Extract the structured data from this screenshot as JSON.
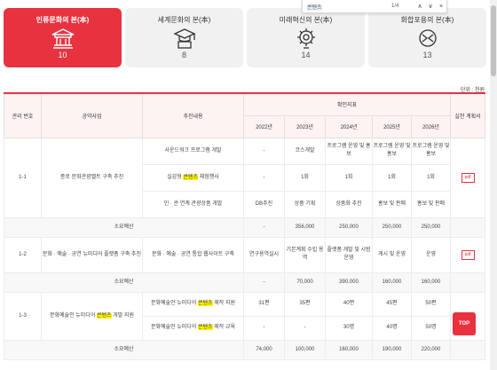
{
  "find": {
    "query": "콘텐츠",
    "count": "1/4",
    "up": "∧",
    "down": "∨",
    "close": "×"
  },
  "cards": [
    {
      "title": "인류문화의 본(本)",
      "count": "10",
      "icon": "palace-icon"
    },
    {
      "title": "세계문화의 본(本)",
      "count": "8",
      "icon": "graduation-cap-icon"
    },
    {
      "title": "미래혁신의 본(本)",
      "count": "14",
      "icon": "gear-bulb-icon"
    },
    {
      "title": "화합포용의 본(本)",
      "count": "13",
      "icon": "joined-hands-icon"
    }
  ],
  "unit": "단위 : 천원",
  "table": {
    "h_no": "관리 번호",
    "h_project": "공약사업",
    "h_content": "추진내용",
    "h_indicator": "확인지표",
    "h_plan": "실천 계획서",
    "years": [
      "2022년",
      "2023년",
      "2024년",
      "2025년",
      "2026년"
    ],
    "budget_label": "소요예산",
    "pdf_label": "pdf",
    "groups": [
      {
        "no": "1-1",
        "project": "종로 문화관광벨트 구축 추진",
        "rows": [
          {
            "pre": "사운드워크 프로그램 개발",
            "hl": "",
            "post": "",
            "vals": [
              "-",
              "코스개발",
              "프로그램 운영 및 홍보",
              "프로그램 운영 및 홍보",
              "프로그램 운영 및 홍보"
            ]
          },
          {
            "pre": "실감형 ",
            "hl": "콘텐츠",
            "post": " 체험행사",
            "vals": [
              "-",
              "1회",
              "1회",
              "1회",
              "1회"
            ]
          },
          {
            "pre": "민 · 관 연계 관광상품 개발",
            "hl": "",
            "post": "",
            "vals": [
              "DB추진",
              "상품 기획",
              "상품화 추진",
              "홍보 및 판매",
              "홍보 및 판매"
            ]
          }
        ],
        "budget": [
          "-",
          "356,000",
          "250,000",
          "250,000",
          "250,000"
        ]
      },
      {
        "no": "1-2",
        "project": "문화 · 예술 · 공연 뉴미디어 플랫폼 구축 추진",
        "rows": [
          {
            "pre": "문화 · 예술 · 공연 통합 웹사이트 구축",
            "hl": "",
            "post": "",
            "vals": [
              "연구용역실시",
              "기본계획 수립 용역",
              "플랫폼 개발 및 시범운영",
              "게시 및 운영",
              "운영"
            ]
          }
        ],
        "budget": [
          "-",
          "70,000",
          "390,000",
          "160,000",
          "160,000"
        ]
      },
      {
        "no": "1-3",
        "project_pre": "문화예술인 뉴미디어 ",
        "project_hl": "콘텐츠",
        "project_post": " 개발 지원",
        "rows": [
          {
            "pre": "문화예술인 뉴미디어 ",
            "hl": "콘텐츠",
            "post": " 제작 지원",
            "vals": [
              "31편",
              "35편",
              "40편",
              "45편",
              "50편"
            ]
          },
          {
            "pre": "문화예술인 뉴미디어 ",
            "hl": "콘텐츠",
            "post": " 제작 교육",
            "vals": [
              "-",
              "-",
              "30명",
              "40명",
              "50명"
            ]
          }
        ],
        "budget": [
          "74,000",
          "100,000",
          "160,000",
          "190,000",
          "220,000"
        ]
      }
    ]
  },
  "top_button": "TOP",
  "colors": {
    "accent": "#e8323f",
    "highlight": "#fff200"
  }
}
